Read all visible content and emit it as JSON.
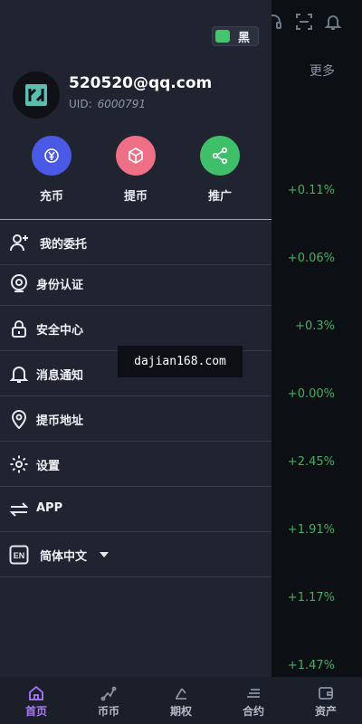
{
  "theme_toggle": {
    "label": "黑"
  },
  "background": {
    "more_label": "更多",
    "percents": [
      "+0.11%",
      "+0.06%",
      "+0.3%",
      "+0.00%",
      "+2.45%",
      "+1.91%",
      "+1.17%",
      "+1.47%"
    ]
  },
  "profile": {
    "email": "520520@qq.com",
    "uid_label": "UID:",
    "uid_value": "6000791"
  },
  "actions": [
    {
      "label": "充币",
      "color": "#4a5ae6",
      "icon": "deposit-icon"
    },
    {
      "label": "提币",
      "color": "#ef6f86",
      "icon": "withdraw-icon"
    },
    {
      "label": "推广",
      "color": "#3fbf6a",
      "icon": "share-icon"
    }
  ],
  "menu": [
    {
      "label": "我的委托",
      "icon": "user-plus-icon"
    },
    {
      "label": "身份认证",
      "icon": "camera-icon"
    },
    {
      "label": "安全中心",
      "icon": "lock-icon"
    },
    {
      "label": "消息通知",
      "icon": "bell-icon"
    },
    {
      "label": "提币地址",
      "icon": "location-icon"
    },
    {
      "label": "设置",
      "icon": "gear-icon"
    },
    {
      "label": "APP",
      "icon": "transfer-icon"
    },
    {
      "label": "简体中文",
      "icon": "language-icon",
      "badge": "EN"
    }
  ],
  "watermark": "dajian168.com",
  "tabs": [
    {
      "label": "首页",
      "icon": "home-icon",
      "active": true
    },
    {
      "label": "币币",
      "icon": "coin-icon"
    },
    {
      "label": "期权",
      "icon": "options-icon"
    },
    {
      "label": "合约",
      "icon": "contract-icon"
    },
    {
      "label": "资产",
      "icon": "wallet-icon"
    }
  ],
  "colors": {
    "drawer": "#202431",
    "accent": "#a879ff",
    "positive": "#3fb15d"
  }
}
